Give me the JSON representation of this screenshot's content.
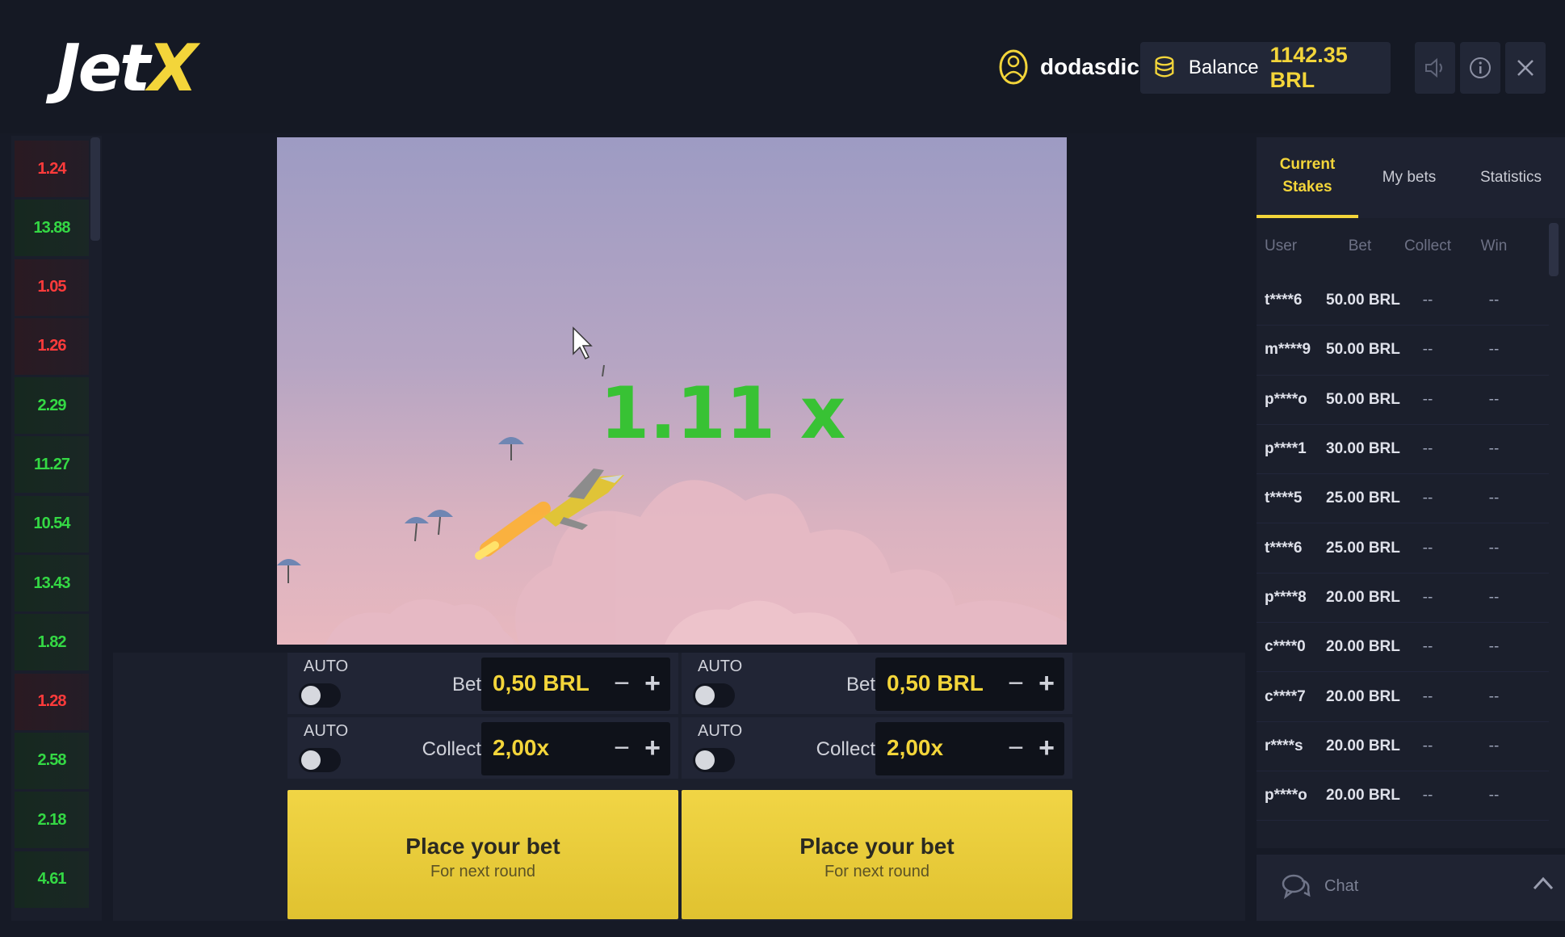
{
  "header": {
    "logo_main": "Jet",
    "logo_accent": "X",
    "username": "dodasdic",
    "balance_label": "Balance",
    "balance_value": "1142.35 BRL"
  },
  "history": [
    "1.24",
    "13.88",
    "1.05",
    "1.26",
    "2.29",
    "11.27",
    "10.54",
    "13.43",
    "1.82",
    "1.28",
    "2.58",
    "2.18",
    "4.61"
  ],
  "history_colors": [
    "red",
    "green",
    "red",
    "red",
    "green",
    "green",
    "green",
    "green",
    "green",
    "red",
    "green",
    "green",
    "green"
  ],
  "game": {
    "multiplier": "1.11 x"
  },
  "panels": [
    {
      "auto_label_1": "AUTO",
      "bet_label": "Bet",
      "bet_value": "0,50 BRL",
      "auto_label_2": "AUTO",
      "collect_label": "Collect",
      "collect_value": "2,00x",
      "button_main": "Place your bet",
      "button_sub": "For next round"
    },
    {
      "auto_label_1": "AUTO",
      "bet_label": "Bet",
      "bet_value": "0,50 BRL",
      "auto_label_2": "AUTO",
      "collect_label": "Collect",
      "collect_value": "2,00x",
      "button_main": "Place your bet",
      "button_sub": "For next round"
    }
  ],
  "side": {
    "tabs": [
      "Current Stakes",
      "My bets",
      "Statistics"
    ],
    "columns": [
      "User",
      "Bet",
      "Collect",
      "Win"
    ],
    "rows": [
      {
        "user": "t****6",
        "bet": "50.00 BRL",
        "collect": "--",
        "win": "--"
      },
      {
        "user": "m****9",
        "bet": "50.00 BRL",
        "collect": "--",
        "win": "--"
      },
      {
        "user": "p****o",
        "bet": "50.00 BRL",
        "collect": "--",
        "win": "--"
      },
      {
        "user": "p****1",
        "bet": "30.00 BRL",
        "collect": "--",
        "win": "--"
      },
      {
        "user": "t****5",
        "bet": "25.00 BRL",
        "collect": "--",
        "win": "--"
      },
      {
        "user": "t****6",
        "bet": "25.00 BRL",
        "collect": "--",
        "win": "--"
      },
      {
        "user": "p****8",
        "bet": "20.00 BRL",
        "collect": "--",
        "win": "--"
      },
      {
        "user": "c****0",
        "bet": "20.00 BRL",
        "collect": "--",
        "win": "--"
      },
      {
        "user": "c****7",
        "bet": "20.00 BRL",
        "collect": "--",
        "win": "--"
      },
      {
        "user": "r****s",
        "bet": "20.00 BRL",
        "collect": "--",
        "win": "--"
      },
      {
        "user": "p****o",
        "bet": "20.00 BRL",
        "collect": "--",
        "win": "--"
      }
    ],
    "chat_label": "Chat"
  },
  "colors": {
    "accent": "#f3d53a",
    "multiplier": "#38c234",
    "history_red": "#ff3b3b",
    "history_green": "#34d844"
  }
}
